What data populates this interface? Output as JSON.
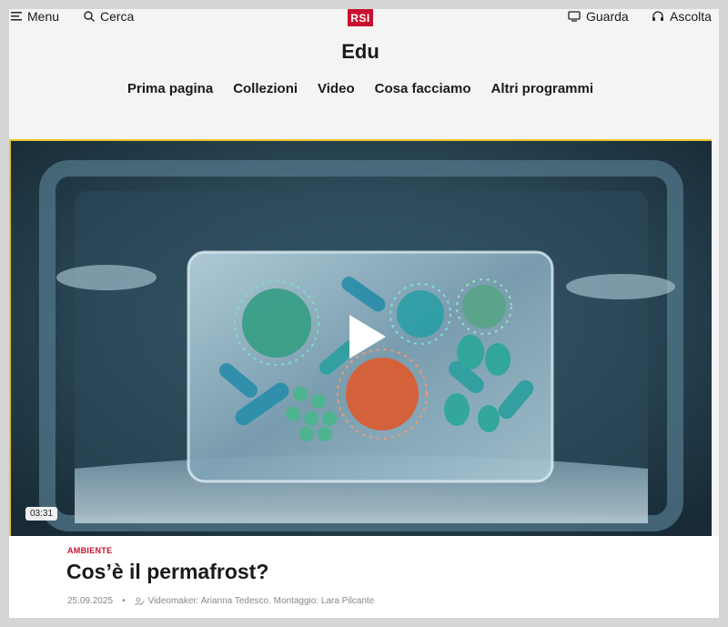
{
  "header": {
    "menu_label": "Menu",
    "search_label": "Cerca",
    "logo_text": "RSI",
    "watch_label": "Guarda",
    "listen_label": "Ascolta",
    "site_title": "Edu"
  },
  "nav": {
    "items": [
      "Prima pagina",
      "Collezioni",
      "Video",
      "Cosa facciamo",
      "Altri programmi"
    ]
  },
  "video": {
    "duration": "03:31"
  },
  "article": {
    "category": "AMBIENTE",
    "title": "Cos’è il permafrost?",
    "date": "25.09.2025",
    "credits": "Videomaker: Arianna Tedesco. Montaggio: Lara Pilcante"
  },
  "colors": {
    "brand_red": "#c8102e",
    "accent_yellow": "#e6c229"
  }
}
